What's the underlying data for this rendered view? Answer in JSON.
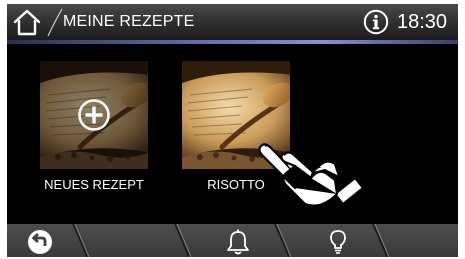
{
  "header": {
    "title": "MEINE REZEPTE",
    "time": "18:30",
    "home_icon": "home-icon",
    "info_icon": "info-icon"
  },
  "recipes": [
    {
      "label": "NEUES REZEPT",
      "icon": "plus-icon"
    },
    {
      "label": "RISOTTO"
    }
  ],
  "bottom_nav": {
    "items": [
      {
        "icon": "back-arrow-icon"
      },
      {
        "icon": "bell-icon"
      },
      {
        "icon": "lightbulb-icon"
      }
    ]
  },
  "colors": {
    "background": "#000000",
    "header_accent": "#8a8fd0",
    "bottom_bar": "#444444"
  }
}
